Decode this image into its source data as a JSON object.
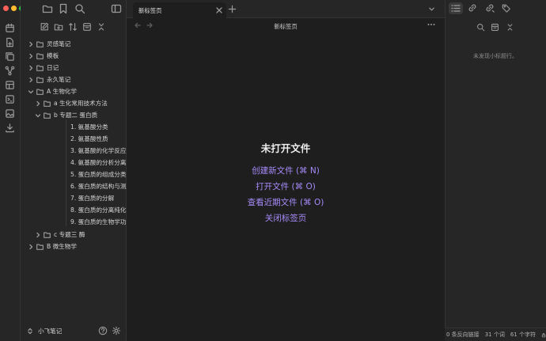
{
  "sidebar": {
    "tree": [
      {
        "label": "灵感笔记"
      },
      {
        "label": "模板"
      },
      {
        "label": "日记"
      },
      {
        "label": "永久笔记"
      },
      {
        "label": "A 生物化学"
      },
      {
        "label": "a 生化常用技术方法"
      },
      {
        "label": "b 专题二 蛋白质"
      },
      {
        "label": "1. 氨基酸分类"
      },
      {
        "label": "2. 氨基酸性质"
      },
      {
        "label": "3. 氨基酸的化学反应"
      },
      {
        "label": "4. 氨基酸的分析分离"
      },
      {
        "label": "5. 蛋白质的组成分类"
      },
      {
        "label": "6. 蛋白质的结构与测序"
      },
      {
        "label": "7. 蛋白质的分解"
      },
      {
        "label": "8. 蛋白质的分离纯化"
      },
      {
        "label": "9. 蛋白质的生物学功能"
      },
      {
        "label": "c 专题三 酶"
      },
      {
        "label": "B 微生物学"
      }
    ],
    "vault_name": "小飞笔记"
  },
  "tabs": [
    {
      "label": "新标签页"
    }
  ],
  "main": {
    "title": "新标签页",
    "heading": "未打开文件",
    "actions": [
      {
        "label": "创建新文件 (⌘ N)"
      },
      {
        "label": "打开文件 (⌘ O)"
      },
      {
        "label": "查看近期文件 (⌘ O)"
      },
      {
        "label": "关闭标签页"
      }
    ]
  },
  "outline": {
    "empty_text": "未发现小标题行。"
  },
  "status": {
    "backlinks": "0 条反向链接",
    "words": "31 个词",
    "chars": "61 个字符"
  },
  "colors": {
    "accent": "#a78bfa",
    "background": "#1e1e1e",
    "panel": "#262626"
  }
}
